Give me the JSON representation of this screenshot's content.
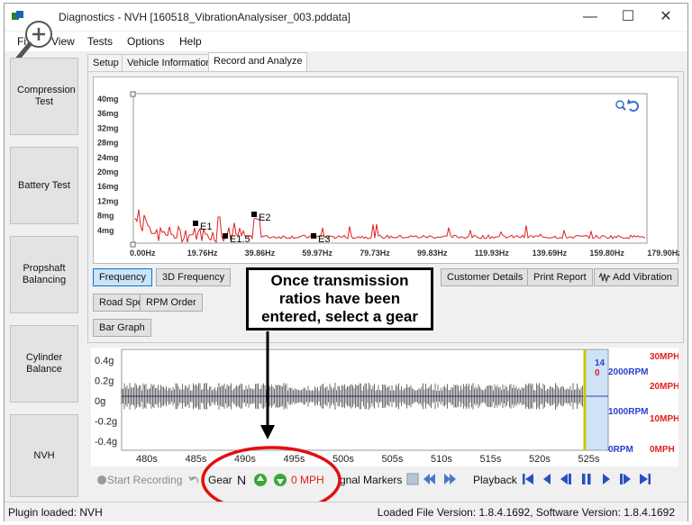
{
  "window": {
    "title": "Pico Diagnostics - NVH [160518_VibrationAnalysiser_003.pddata]",
    "title_visible": "Diagnostics - NVH [160518_VibrationAnalysiser_003.pddata]"
  },
  "window_controls": {
    "minimize": "—",
    "maximize": "☐",
    "close": "✕"
  },
  "menu": {
    "items": [
      "File",
      "View",
      "Tests",
      "Options",
      "Help"
    ],
    "file_visible": "Fi",
    "view_visible": "View"
  },
  "side_buttons": [
    "Compression Test",
    "Battery Test",
    "Propshaft Balancing",
    "Cylinder Balance",
    "NVH"
  ],
  "tabs": [
    {
      "label": "Setup",
      "active": false
    },
    {
      "label": "Vehicle Information",
      "active": false
    },
    {
      "label": "Record and Analyze",
      "active": true
    }
  ],
  "spectrum": {
    "y_ticks": [
      "40mg",
      "36mg",
      "32mg",
      "28mg",
      "24mg",
      "20mg",
      "16mg",
      "12mg",
      "8mg",
      "4mg"
    ],
    "x_ticks": [
      "0.00Hz",
      "19.76Hz",
      "39.86Hz",
      "59.97Hz",
      "79.73Hz",
      "99.83Hz",
      "119.93Hz",
      "139.69Hz",
      "159.80Hz",
      "179.90Hz"
    ],
    "markers": [
      "E1",
      "E1.5",
      "E2",
      "E3"
    ],
    "line_color": "#e02020"
  },
  "tool_buttons": {
    "frequency": "Frequency",
    "frequency_3d": "3D Frequency",
    "road_speed": "Road Speed",
    "rpm_order": "RPM Order",
    "bar_graph": "Bar Graph",
    "customer_details": "Customer Details",
    "print_report": "Print Report",
    "add_vibration": "Add Vibration"
  },
  "callout": {
    "line1": "Once transmission",
    "line2": "ratios have been",
    "line3": "entered, select a gear"
  },
  "timeline": {
    "y_ticks": [
      "0.4g",
      "0.2g",
      "0g",
      "-0.2g",
      "-0.4g"
    ],
    "x_ticks": [
      "480s",
      "485s",
      "490s",
      "495s",
      "500s",
      "505s",
      "510s",
      "515s",
      "520s",
      "525s"
    ],
    "rpm_labels": [
      "2000RPM",
      "1000RPM",
      "0RPM"
    ],
    "mph_labels": [
      "30MPH",
      "20MPH",
      "10MPH",
      "0MPH"
    ],
    "cursor_value": "14",
    "cursor_value2": "0",
    "colors": {
      "rpm": "#2a3fd0",
      "mph": "#e02020",
      "cursor": "#c8c800",
      "selection": "#cfe3f7"
    }
  },
  "playback": {
    "start_recording": "Start Recording",
    "gear_label": "Gear",
    "gear_value": "N",
    "speed": "0 MPH",
    "signal_markers": "gnal Markers",
    "playback_label": "Playback"
  },
  "status": {
    "left": "Plugin loaded: NVH",
    "right": "Loaded File Version: 1.8.4.1692,  Software Version: 1.8.4.1692"
  }
}
